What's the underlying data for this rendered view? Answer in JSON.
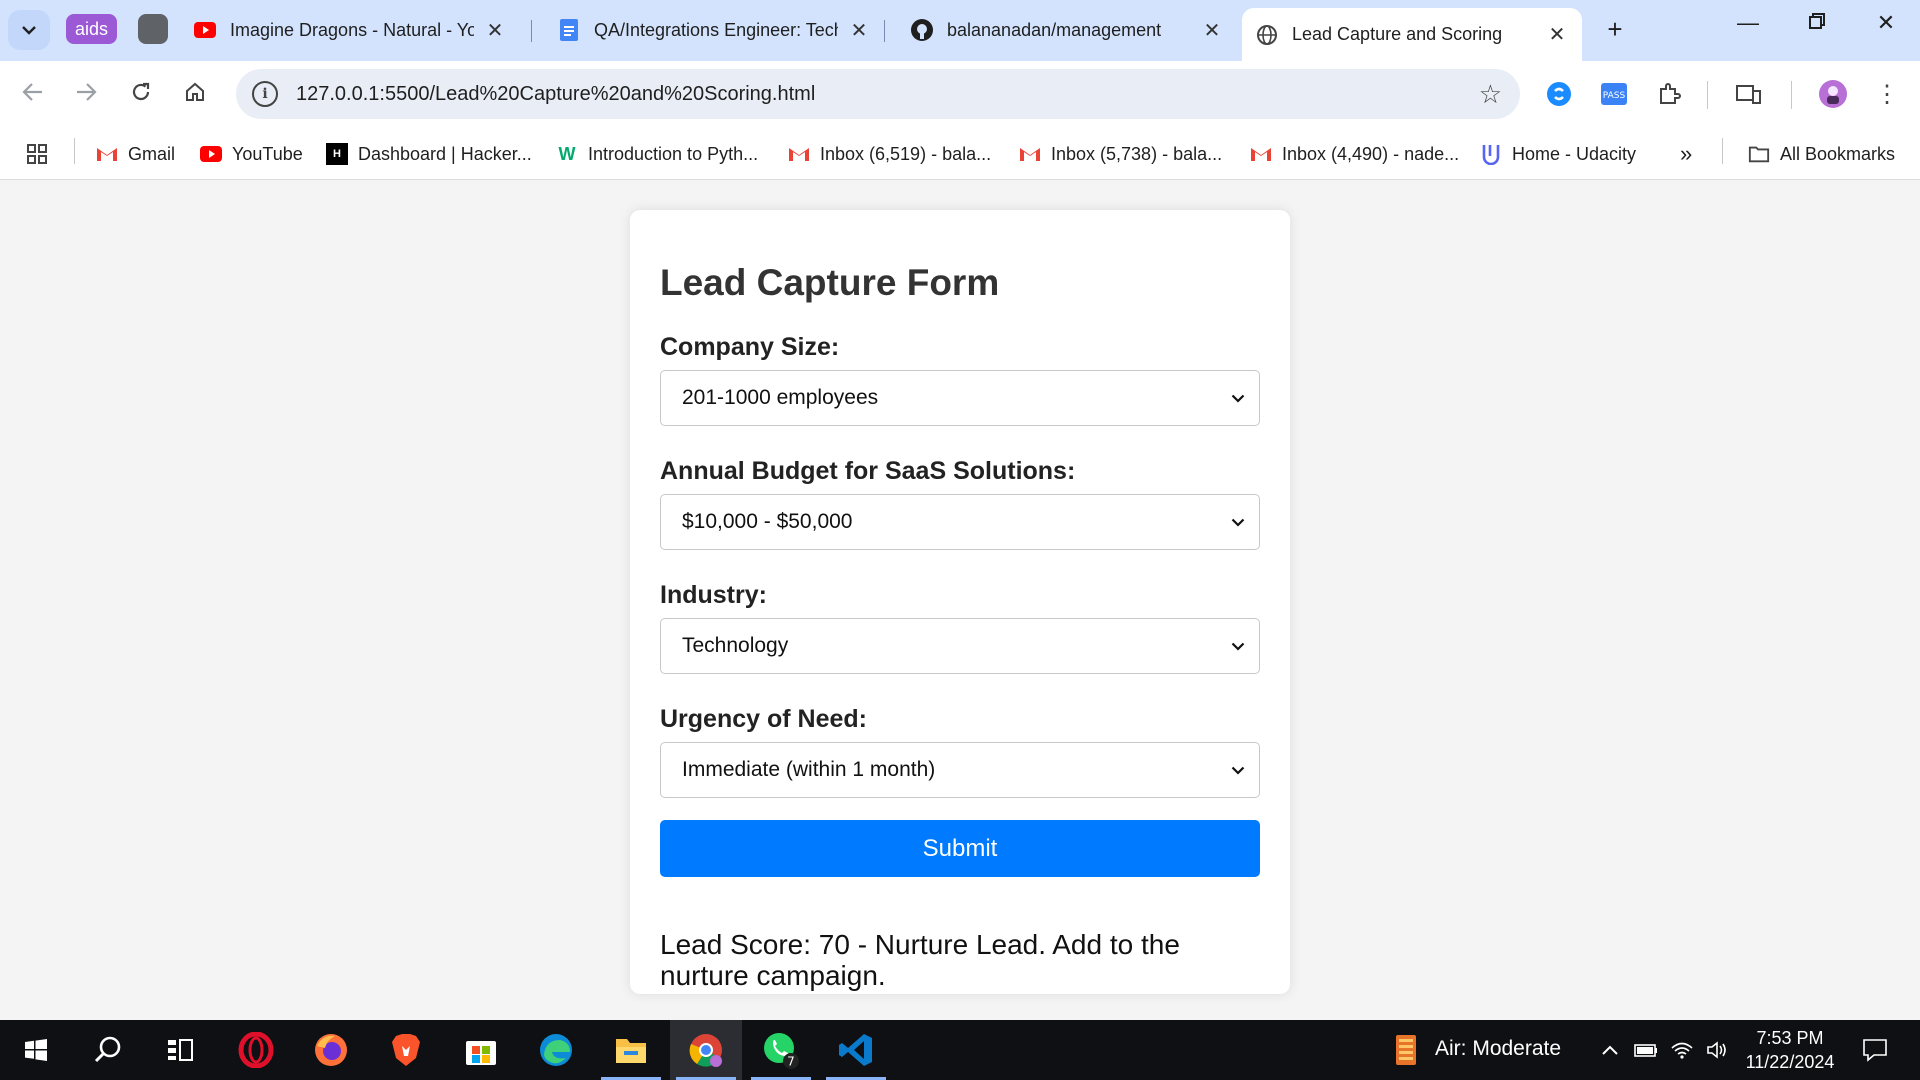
{
  "browser": {
    "tab_groups": [
      {
        "label": "aids",
        "color": "#9b59d6"
      },
      {
        "label": "",
        "color": "#5f6368"
      }
    ],
    "tabs": [
      {
        "title": "Imagine Dragons - Natural - Yo",
        "icon": "youtube-icon"
      },
      {
        "title": "QA/Integrations Engineer: Tech",
        "icon": "google-docs-icon"
      },
      {
        "title": "balananadan/management",
        "icon": "github-icon"
      },
      {
        "title": "Lead Capture and Scoring",
        "icon": "globe-icon",
        "active": true
      }
    ],
    "address": "127.0.0.1:5500/Lead%20Capture%20and%20Scoring.html",
    "bookmarks": [
      {
        "label": "Gmail",
        "icon": "gmail-icon"
      },
      {
        "label": "YouTube",
        "icon": "youtube-icon"
      },
      {
        "label": "Dashboard | Hacker...",
        "icon": "hackerrank-icon"
      },
      {
        "label": "Introduction to Pyth...",
        "icon": "w3-icon"
      },
      {
        "label": "Inbox (6,519) - bala...",
        "icon": "gmail-icon"
      },
      {
        "label": "Inbox (5,738) - bala...",
        "icon": "gmail-icon"
      },
      {
        "label": "Inbox (4,490) - nade...",
        "icon": "gmail-icon"
      },
      {
        "label": "Home - Udacity",
        "icon": "udacity-icon"
      }
    ],
    "bookmarks_overflow": "»",
    "all_bookmarks": "All Bookmarks"
  },
  "form": {
    "title": "Lead Capture Form",
    "fields": [
      {
        "label": "Company Size:",
        "value": "201-1000 employees"
      },
      {
        "label": "Annual Budget for SaaS Solutions:",
        "value": "$10,000 - $50,000"
      },
      {
        "label": "Industry:",
        "value": "Technology"
      },
      {
        "label": "Urgency of Need:",
        "value": "Immediate (within 1 month)"
      }
    ],
    "submit_label": "Submit",
    "result": "Lead Score: 70 - Nurture Lead. Add to the nurture campaign.",
    "accent": "#007bff"
  },
  "taskbar": {
    "apps": [
      "start-icon",
      "search-icon",
      "task-view-icon",
      "opera-icon",
      "firefox-icon",
      "brave-icon",
      "microsoft-store-icon",
      "edge-icon",
      "file-explorer-icon",
      "chrome-icon",
      "whatsapp-icon",
      "vscode-icon"
    ],
    "whatsapp_badge": "7",
    "weather": "Air: Moderate",
    "time": "7:53 PM",
    "date": "11/22/2024"
  }
}
